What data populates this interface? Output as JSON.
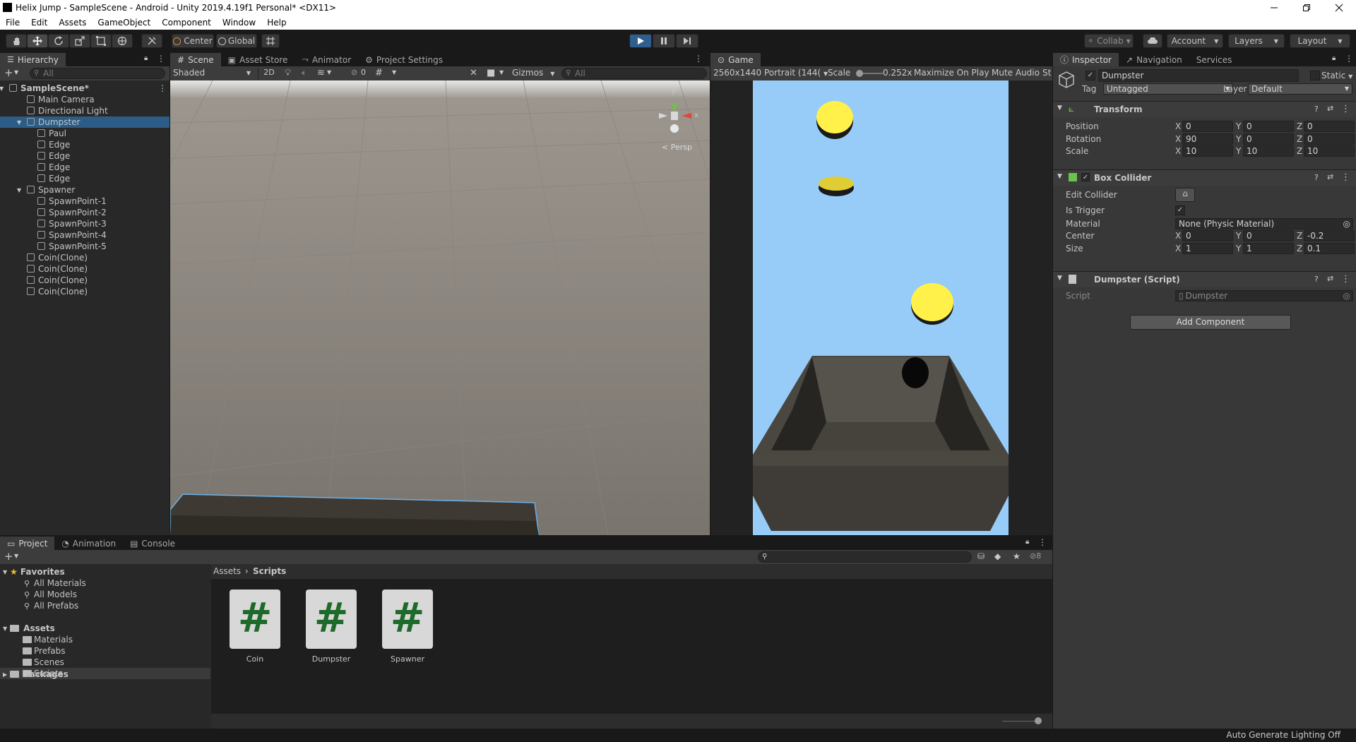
{
  "window": {
    "title": "Helix Jump - SampleScene - Android - Unity 2019.4.19f1 Personal* <DX11>",
    "controls": [
      "minimize-icon",
      "restore-icon",
      "close-icon"
    ]
  },
  "menu": [
    "File",
    "Edit",
    "Assets",
    "GameObject",
    "Component",
    "Window",
    "Help"
  ],
  "toolbar": {
    "tools": [
      "hand-tool-icon",
      "move-tool-icon",
      "rotate-tool-icon",
      "scale-tool-icon",
      "rect-tool-icon",
      "transform-tool-icon",
      "custom-tool-icon"
    ],
    "pivot": "Center",
    "space": "Global",
    "collab": "Collab",
    "account": "Account",
    "layers": "Layers",
    "layout": "Layout"
  },
  "hierarchy": {
    "tab": "Hierarchy",
    "search_placeholder": "All",
    "items": [
      {
        "label": "SampleScene*",
        "depth": 0
      },
      {
        "label": "Main Camera",
        "depth": 1
      },
      {
        "label": "Directional Light",
        "depth": 1
      },
      {
        "label": "Dumpster",
        "depth": 1
      },
      {
        "label": "Paul",
        "depth": 2
      },
      {
        "label": "Edge",
        "depth": 2
      },
      {
        "label": "Edge",
        "depth": 2
      },
      {
        "label": "Edge",
        "depth": 2
      },
      {
        "label": "Edge",
        "depth": 2
      },
      {
        "label": "Spawner",
        "depth": 1
      },
      {
        "label": "SpawnPoint-1",
        "depth": 2
      },
      {
        "label": "SpawnPoint-2",
        "depth": 2
      },
      {
        "label": "SpawnPoint-3",
        "depth": 2
      },
      {
        "label": "SpawnPoint-4",
        "depth": 2
      },
      {
        "label": "SpawnPoint-5",
        "depth": 2
      },
      {
        "label": "Coin(Clone)",
        "depth": 1
      },
      {
        "label": "Coin(Clone)",
        "depth": 1
      },
      {
        "label": "Coin(Clone)",
        "depth": 1
      },
      {
        "label": "Coin(Clone)",
        "depth": 1
      }
    ]
  },
  "scene": {
    "tabs": [
      "Scene",
      "Asset Store",
      "Animator",
      "Project Settings"
    ],
    "shading": "Shaded",
    "mode_2d": "2D",
    "hidden_count": "0",
    "gizmos": "Gizmos",
    "search_placeholder": "All",
    "persp": "Persp",
    "gizmo_axes": [
      "y",
      "x"
    ]
  },
  "game": {
    "tab": "Game",
    "resolution": "2560x1440 Portrait (144(",
    "scale_label": "Scale",
    "scale_value": "0.252x",
    "maximize": "Maximize On Play",
    "mute": "Mute Audio",
    "stats": "St"
  },
  "inspector": {
    "tabs": [
      "Inspector",
      "Navigation",
      "Services"
    ],
    "object_name": "Dumpster",
    "static_label": "Static",
    "tag_label": "Tag",
    "tag_value": "Untagged",
    "layer_label": "Layer",
    "layer_value": "Default",
    "transform": {
      "title": "Transform",
      "position": {
        "label": "Position",
        "x": "0",
        "y": "0",
        "z": "0"
      },
      "rotation": {
        "label": "Rotation",
        "x": "90",
        "y": "0",
        "z": "0"
      },
      "scale": {
        "label": "Scale",
        "x": "10",
        "y": "10",
        "z": "10"
      }
    },
    "box_collider": {
      "title": "Box Collider",
      "edit_collider": "Edit Collider",
      "is_trigger": "Is Trigger",
      "material_label": "Material",
      "material_value": "None (Physic Material)",
      "center": {
        "label": "Center",
        "x": "0",
        "y": "0",
        "z": "-0.2"
      },
      "size": {
        "label": "Size",
        "x": "1",
        "y": "1",
        "z": "0.1"
      }
    },
    "script_comp": {
      "title": "Dumpster (Script)",
      "script_label": "Script",
      "script_value": "Dumpster"
    },
    "add_component": "Add Component",
    "axis_labels": [
      "X",
      "Y",
      "Z"
    ]
  },
  "project": {
    "tabs": [
      "Project",
      "Animation",
      "Console"
    ],
    "hidden_count": "8",
    "favorites_label": "Favorites",
    "favorites": [
      "All Materials",
      "All Models",
      "All Prefabs"
    ],
    "assets_label": "Assets",
    "asset_folders": [
      "Materials",
      "Prefabs",
      "Scenes",
      "Scripts"
    ],
    "packages_label": "Packages",
    "breadcrumb": [
      "Assets",
      "Scripts"
    ],
    "files": [
      {
        "name": "Coin",
        "glyph": "#"
      },
      {
        "name": "Dumpster",
        "glyph": "#"
      },
      {
        "name": "Spawner",
        "glyph": "#"
      }
    ]
  },
  "status": {
    "text": "Auto Generate Lighting Off"
  },
  "colors": {
    "sky": "#96ccf7",
    "coin": "#fff04a",
    "selection": "#2c5d87",
    "script_hash": "#1d6a2a"
  }
}
